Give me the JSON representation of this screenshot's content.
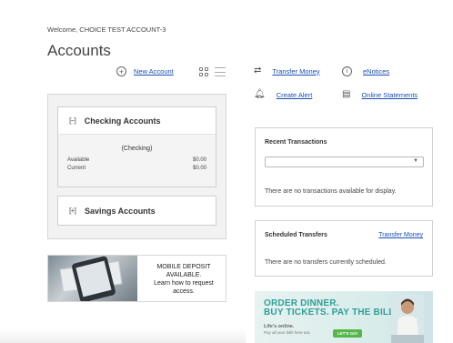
{
  "header": {
    "welcome": "Welcome, CHOICE TEST ACCOUNT-3",
    "title": "Accounts"
  },
  "toolbar": {
    "new_account": "New Account",
    "transfer_money": "Transfer Money",
    "enotices": "eNotices",
    "create_alert": "Create Alert",
    "online_statements": "Online Statements"
  },
  "accounts": {
    "checking": {
      "title": "Checking Accounts",
      "account_name": "(Checking)",
      "rows": [
        {
          "label": "Available",
          "value": "$0.00"
        },
        {
          "label": "Current",
          "value": "$0.00"
        }
      ]
    },
    "savings": {
      "title": "Savings Accounts"
    }
  },
  "promo": {
    "line1": "MOBILE DEPOSIT",
    "line2": "AVAILABLE.",
    "line3": "Learn how to request",
    "line4": "access."
  },
  "recent_transactions": {
    "title": "Recent Transactions",
    "select_value": "",
    "empty_message": "There are no transactions available for display."
  },
  "scheduled_transfers": {
    "title": "Scheduled Transfers",
    "link": "Transfer Money",
    "empty_message": "There are no transfers currently scheduled."
  },
  "banner": {
    "line1": "ORDER DINNER.",
    "line2": "BUY TICKETS. PAY THE BILLS.",
    "sub1": "Life's online.",
    "sub2": "Pay all your bills here too.",
    "button": "LET'S GO!"
  },
  "colors": {
    "link": "#1a4fb5",
    "banner_heading": "#2e9e96",
    "banner_button": "#57b64a"
  }
}
